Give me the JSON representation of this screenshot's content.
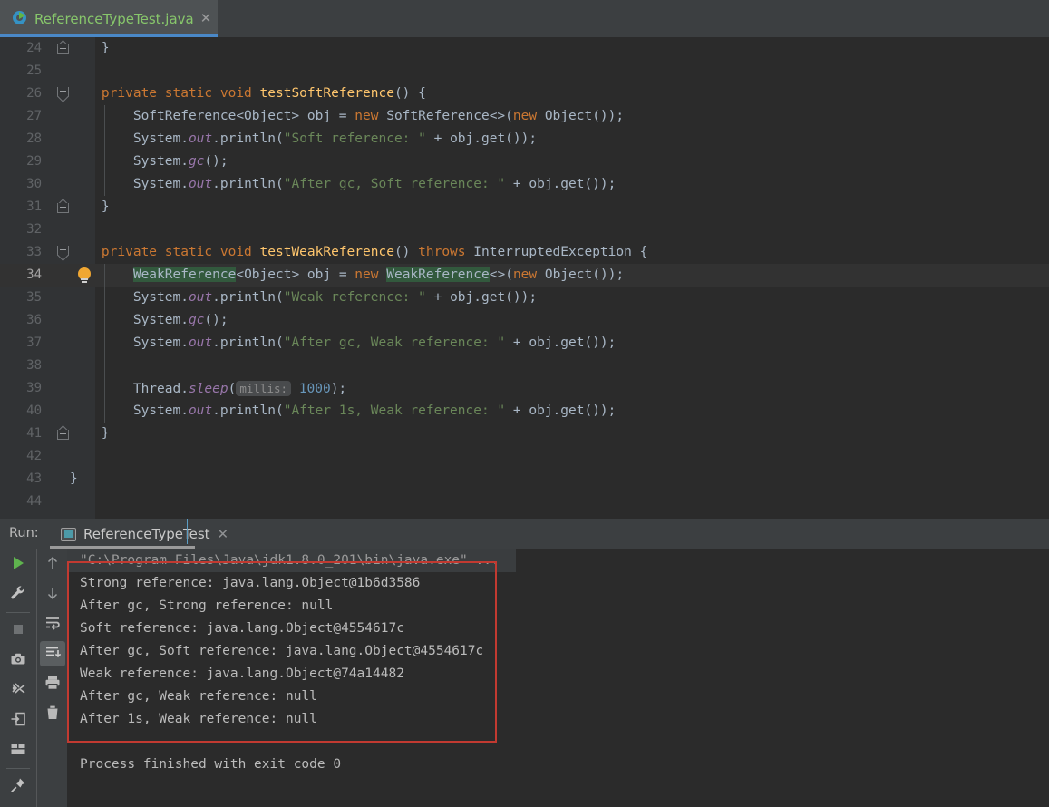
{
  "window": {
    "theme_bg": "#2b2b2b",
    "panel_bg": "#3c3f41",
    "accent": "#4a88c7",
    "annotation_color": "#c23a31"
  },
  "editor_tab": {
    "title": "ReferenceTypeTest.java",
    "close_label": "✕",
    "icon": "run-class-icon"
  },
  "editor": {
    "first_line": 24,
    "current_line": 34,
    "lines": [
      {
        "n": 24,
        "fold": "up",
        "html": "    }"
      },
      {
        "n": 25,
        "fold": null,
        "html": ""
      },
      {
        "n": 26,
        "fold": "down",
        "html": "    <span class=\"kw\">private static void</span> <span class=\"mth\">testSoftReference</span>() {"
      },
      {
        "n": 27,
        "fold": null,
        "html": "        SoftReference&lt;Object&gt; obj = <span class=\"kw\">new</span> SoftReference&lt;&gt;(<span class=\"kw\">new</span> Object());"
      },
      {
        "n": 28,
        "fold": null,
        "html": "        System.<span class=\"fld\">out</span>.println(<span class=\"str\">\"Soft reference: \"</span> + obj.get());"
      },
      {
        "n": 29,
        "fold": null,
        "html": "        System.<span class=\"fld\">gc</span>();"
      },
      {
        "n": 30,
        "fold": null,
        "html": "        System.<span class=\"fld\">out</span>.println(<span class=\"str\">\"After gc, Soft reference: \"</span> + obj.get());"
      },
      {
        "n": 31,
        "fold": "up",
        "html": "    }"
      },
      {
        "n": 32,
        "fold": null,
        "html": ""
      },
      {
        "n": 33,
        "fold": "down",
        "html": "    <span class=\"kw\">private static void</span> <span class=\"mth\">testWeakReference</span>() <span class=\"kw\">throws</span> InterruptedException {"
      },
      {
        "n": 34,
        "fold": null,
        "bulb": true,
        "html": "        <span class=\"hl\">WeakReference</span>&lt;Object&gt; obj = <span class=\"kw\">new</span> <span class=\"hl\">WeakReference</span>&lt;&gt;(<span class=\"kw\">new</span> Object());"
      },
      {
        "n": 35,
        "fold": null,
        "html": "        System.<span class=\"fld\">out</span>.println(<span class=\"str\">\"Weak reference: \"</span> + obj.get());"
      },
      {
        "n": 36,
        "fold": null,
        "html": "        System.<span class=\"fld\">gc</span>();"
      },
      {
        "n": 37,
        "fold": null,
        "html": "        System.<span class=\"fld\">out</span>.println(<span class=\"str\">\"After gc, Weak reference: \"</span> + obj.get());"
      },
      {
        "n": 38,
        "fold": null,
        "html": ""
      },
      {
        "n": 39,
        "fold": null,
        "html": "        Thread.<span class=\"fld\">sleep</span>(<span class=\"phint\">millis:</span> <span class=\"num\">1000</span>);"
      },
      {
        "n": 40,
        "fold": null,
        "html": "        System.<span class=\"fld\">out</span>.println(<span class=\"str\">\"After 1s, Weak reference: \"</span> + obj.get());"
      },
      {
        "n": 41,
        "fold": "up",
        "html": "    }"
      },
      {
        "n": 42,
        "fold": null,
        "html": ""
      },
      {
        "n": 43,
        "fold": null,
        "html": "}"
      },
      {
        "n": 44,
        "fold": null,
        "html": ""
      }
    ],
    "parameter_hint": "millis:",
    "highlighted_identifier": "WeakReference"
  },
  "run_panel": {
    "label": "Run:",
    "tab_title": "ReferenceTypeTest",
    "tab_close_label": "✕",
    "tab_icon": "console-icon",
    "toolbar_left": [
      {
        "name": "rerun-button",
        "icon": "play-icon"
      },
      {
        "name": "edit-configurations-button",
        "icon": "wrench-icon"
      },
      {
        "name": "stop-button",
        "icon": "stop-icon"
      },
      {
        "name": "screenshot-button",
        "icon": "camera-icon"
      },
      {
        "name": "dump-threads-button",
        "icon": "thread-dump-icon"
      },
      {
        "name": "restore-layout-button",
        "icon": "export-icon"
      },
      {
        "name": "layout-settings-button",
        "icon": "layout-icon"
      },
      {
        "name": "pin-tab-button",
        "icon": "pin-icon"
      }
    ],
    "toolbar_right": [
      {
        "name": "up-the-stack-trace-button",
        "icon": "arrow-up-icon"
      },
      {
        "name": "down-the-stack-trace-button",
        "icon": "arrow-down-icon"
      },
      {
        "name": "soft-wrap-button",
        "icon": "soft-wrap-icon"
      },
      {
        "name": "scroll-to-end-button",
        "icon": "scroll-to-end-icon",
        "active": true
      },
      {
        "name": "print-button",
        "icon": "print-icon"
      },
      {
        "name": "clear-all-button",
        "icon": "trash-icon"
      }
    ],
    "console": {
      "command_line": "\"C:\\Program Files\\Java\\jdk1.8.0_201\\bin\\java.exe\" ...",
      "output": [
        "Strong reference: java.lang.Object@1b6d3586",
        "After gc, Strong reference: null",
        "Soft reference: java.lang.Object@4554617c",
        "After gc, Soft reference: java.lang.Object@4554617c",
        "Weak reference: java.lang.Object@74a14482",
        "After gc, Weak reference: null",
        "After 1s, Weak reference: null"
      ],
      "exit_message": "Process finished with exit code 0"
    }
  }
}
